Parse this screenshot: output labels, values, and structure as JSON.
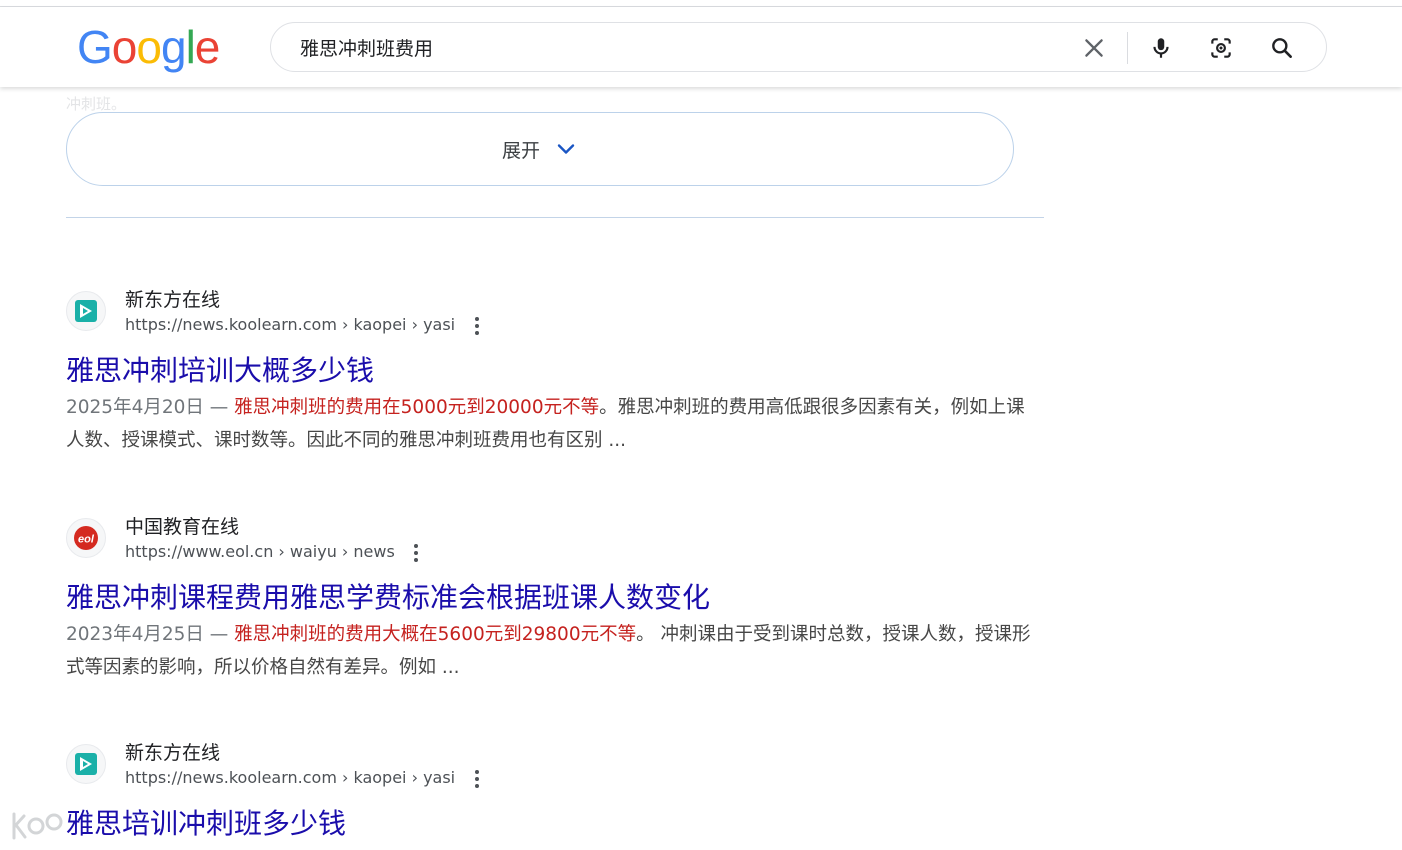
{
  "header": {
    "logo_letters": [
      {
        "ch": "G",
        "color": "#4285F4"
      },
      {
        "ch": "o",
        "color": "#EA4335"
      },
      {
        "ch": "o",
        "color": "#FBBC05"
      },
      {
        "ch": "g",
        "color": "#4285F4"
      },
      {
        "ch": "l",
        "color": "#34A853"
      },
      {
        "ch": "e",
        "color": "#EA4335"
      }
    ],
    "search_query": "雅思冲刺班费用",
    "icons": [
      "close-icon",
      "microphone-icon",
      "lens-camera-icon",
      "search-icon"
    ]
  },
  "faded_text": "冲刺班。",
  "expand": {
    "label": "展开",
    "icon": "chevron-down-icon"
  },
  "results": [
    {
      "site_name": "新东方在线",
      "url": "https://news.koolearn.com › kaopei › yasi",
      "favicon": "koolearn-logo-icon",
      "title": "雅思冲刺培训大概多少钱",
      "date": "2025年4月20日 — ",
      "highlight": "雅思冲刺班的费用在5000元到20000元不等",
      "rest": "。雅思冲刺班的费用高低跟很多因素有关，例如上课人数、授课模式、课时数等。因此不同的雅思冲刺班费用也有区别 ..."
    },
    {
      "site_name": "中国教育在线",
      "url": "https://www.eol.cn › waiyu › news",
      "favicon": "eol-logo-icon",
      "title": "雅思冲刺课程费用雅思学费标准会根据班课人数变化",
      "date": "2023年4月25日 — ",
      "highlight": "雅思冲刺班的费用大概在5600元到29800元不等",
      "rest": "。 冲刺课由于受到课时总数，授课人数，授课形式等因素的影响，所以价格自然有差异。例如 ..."
    },
    {
      "site_name": "新东方在线",
      "url": "https://news.koolearn.com › kaopei › yasi",
      "favicon": "koolearn-logo-icon",
      "title": "雅思培训冲刺班多少钱"
    }
  ],
  "watermark": {
    "text": "Koo"
  },
  "colors": {
    "link": "#1a0dab",
    "highlight": "#c5221f",
    "body_text": "#474747"
  }
}
